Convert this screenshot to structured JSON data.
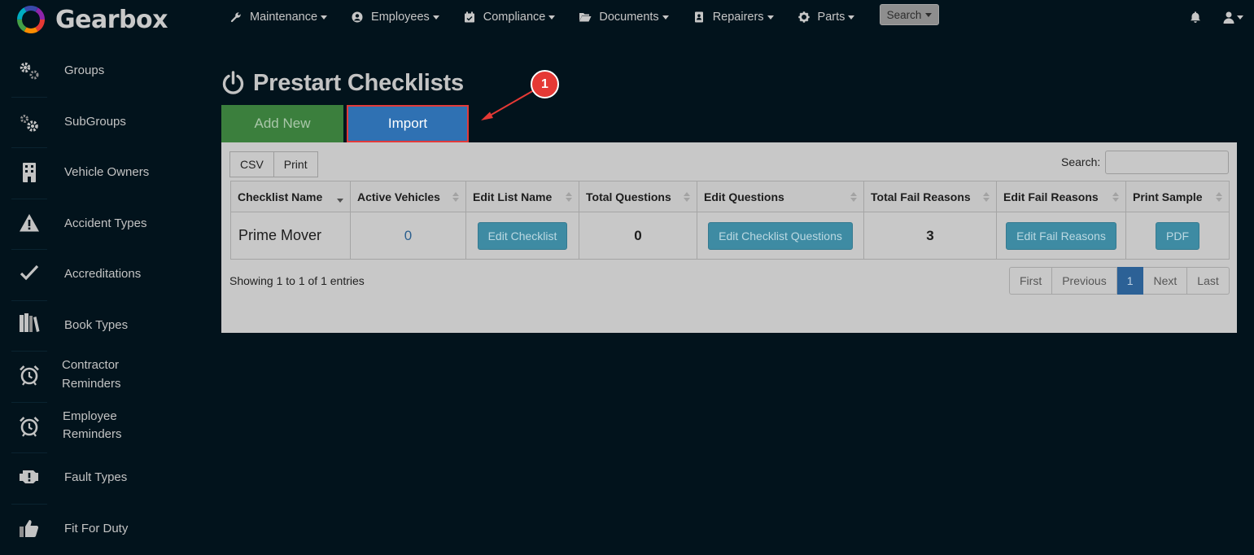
{
  "app": {
    "name": "Gearbox"
  },
  "nav": {
    "items": [
      {
        "label": "Maintenance",
        "icon": "wrench-icon"
      },
      {
        "label": "Employees",
        "icon": "person-circle-icon"
      },
      {
        "label": "Compliance",
        "icon": "calendar-check-icon"
      },
      {
        "label": "Documents",
        "icon": "folder-open-icon"
      },
      {
        "label": "Repairers",
        "icon": "address-book-icon"
      },
      {
        "label": "Parts",
        "icon": "gear-icon"
      }
    ],
    "search_label": "Search"
  },
  "sidebar": {
    "items": [
      {
        "label": "Groups",
        "icon": "gears-icon"
      },
      {
        "label": "SubGroups",
        "icon": "gears-icon"
      },
      {
        "label": "Vehicle Owners",
        "icon": "building-icon"
      },
      {
        "label": "Accident Types",
        "icon": "warning-icon"
      },
      {
        "label": "Accreditations",
        "icon": "checkmark-icon"
      },
      {
        "label": "Book Types",
        "icon": "books-icon"
      },
      {
        "label": "Contractor Reminders",
        "icon": "alarm-clock-icon"
      },
      {
        "label": "Employee Reminders",
        "icon": "alarm-clock-icon"
      },
      {
        "label": "Fault Types",
        "icon": "engine-warning-icon"
      },
      {
        "label": "Fit For Duty",
        "icon": "thumbs-up-icon"
      }
    ]
  },
  "page": {
    "title": "Prestart Checklists",
    "add_new_label": "Add New",
    "import_label": "Import"
  },
  "table_tools": {
    "csv_label": "CSV",
    "print_label": "Print",
    "search_label": "Search:",
    "search_value": ""
  },
  "table": {
    "columns": [
      "Checklist Name",
      "Active Vehicles",
      "Edit List Name",
      "Total Questions",
      "Edit Questions",
      "Total Fail Reasons",
      "Edit Fail Reasons",
      "Print Sample"
    ],
    "rows": [
      {
        "checklist_name": "Prime Mover",
        "active_vehicles": "0",
        "edit_list_name": "Edit Checklist",
        "total_questions": "0",
        "edit_questions": "Edit Checklist Questions",
        "total_fail_reasons": "3",
        "edit_fail_reasons": "Edit Fail Reasons",
        "print_sample": "PDF"
      }
    ],
    "info": "Showing 1 to 1 of 1 entries"
  },
  "pagination": {
    "first": "First",
    "previous": "Previous",
    "current": "1",
    "next": "Next",
    "last": "Last"
  },
  "annotation": {
    "badge": "1"
  },
  "colors": {
    "background": "#02131c",
    "add_button": "#3b7f3d",
    "import_button": "#2f71b3",
    "highlight": "#e23b3b",
    "cell_button": "#3e8ba3",
    "pager_active": "#2c6196"
  }
}
